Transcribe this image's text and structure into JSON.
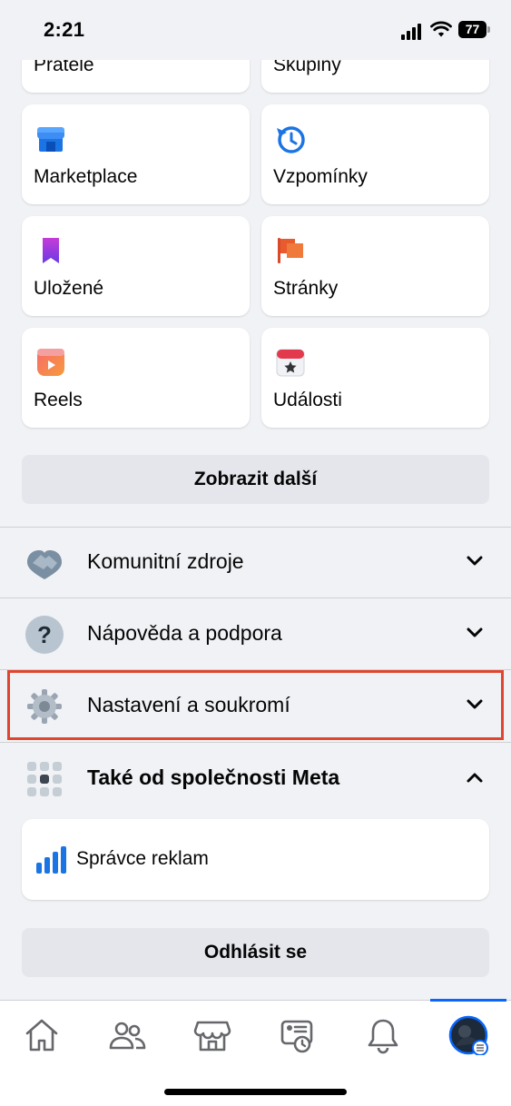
{
  "status_bar": {
    "time": "2:21",
    "battery": "77"
  },
  "shortcuts": [
    {
      "label": "Přátelé",
      "icon": "friends-icon"
    },
    {
      "label": "Skupiny",
      "icon": "groups-icon"
    },
    {
      "label": "Marketplace",
      "icon": "marketplace-icon"
    },
    {
      "label": "Vzpomínky",
      "icon": "memories-icon"
    },
    {
      "label": "Uložené",
      "icon": "saved-icon"
    },
    {
      "label": "Stránky",
      "icon": "pages-icon"
    },
    {
      "label": "Reels",
      "icon": "reels-icon"
    },
    {
      "label": "Události",
      "icon": "events-icon"
    }
  ],
  "show_more_label": "Zobrazit další",
  "sections": [
    {
      "label": "Komunitní zdroje",
      "icon": "handshake-icon",
      "expanded": false
    },
    {
      "label": "Nápověda a podpora",
      "icon": "help-icon",
      "expanded": false
    },
    {
      "label": "Nastavení a soukromí",
      "icon": "gear-icon",
      "expanded": false
    },
    {
      "label": "Také od společnosti Meta",
      "icon": "meta-apps-icon",
      "expanded": true
    }
  ],
  "meta_apps": [
    {
      "label": "Správce reklam",
      "icon": "ads-manager-icon"
    }
  ],
  "logout_label": "Odhlásit se",
  "tab_bar": {
    "tabs": [
      "home-icon",
      "friends-tab-icon",
      "marketplace-tab-icon",
      "memories-tab-icon",
      "notifications-icon",
      "profile-menu-icon"
    ],
    "active": "profile-menu-icon"
  },
  "colors": {
    "accent": "#0866ff",
    "highlight": "#e0452e",
    "background": "#f0f2f5"
  }
}
